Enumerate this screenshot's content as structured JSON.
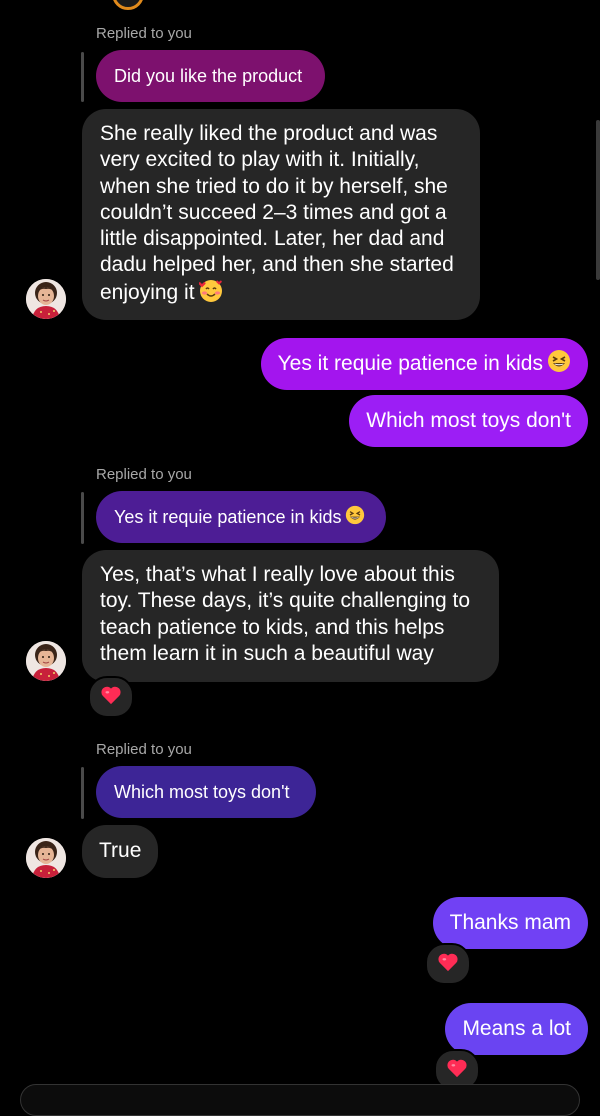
{
  "colors": {
    "background": "#000000",
    "incoming_bubble": "#262626",
    "reply_label": "#a8a8a8",
    "quote_1": "#7d116e",
    "quote_2": "#4d1d95",
    "quote_3": "#3d2596",
    "out_1": "#a315ee",
    "out_2": "#9c1ef5",
    "out_3": "#7141f4",
    "out_4": "#6a44f2",
    "reaction_heart": "#ff2c55"
  },
  "thread": {
    "reply_1": {
      "label": "Replied to you",
      "quoted": "Did you like the product",
      "message": "She really liked the product and was very excited to play with it. Initially, when she tried to do it by herself, she couldn’t succeed 2–3 times and got a little disappointed. Later, her dad and dadu helped her, and then she started enjoying it",
      "message_emoji": "smiling-face-with-hearts"
    },
    "outgoing_1": {
      "text": "Yes it requie patience in kids",
      "emoji": "grinning-squinting-face"
    },
    "outgoing_2": {
      "text": "Which most toys don't"
    },
    "reply_2": {
      "label": "Replied to you",
      "quoted": "Yes it requie patience in kids",
      "quoted_emoji": "grinning-squinting-face",
      "message": "Yes, that’s what I really love about this toy. These days, it’s quite challenging to teach patience to kids, and this helps them learn it in such a beautiful way",
      "reaction": "heart-icon"
    },
    "reply_3": {
      "label": "Replied to you",
      "quoted": "Which most toys don't",
      "message": "True"
    },
    "outgoing_3": {
      "text": "Thanks mam",
      "reaction": "heart-icon"
    },
    "outgoing_4": {
      "text": "Means a lot",
      "reaction": "heart-icon"
    }
  }
}
